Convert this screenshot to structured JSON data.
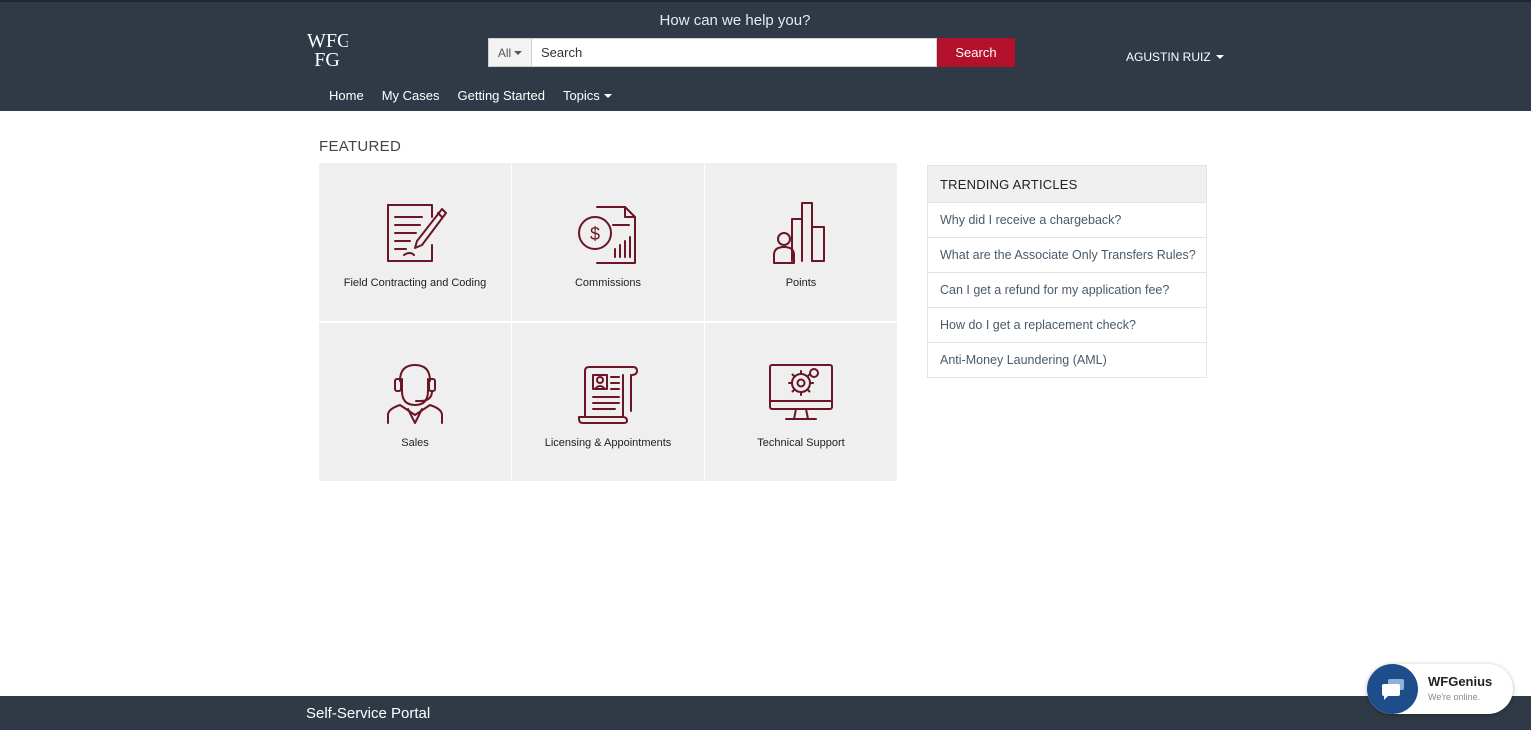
{
  "header": {
    "logo_text": "WFG",
    "help_text": "How can we help you?",
    "search": {
      "scope_label": "All",
      "placeholder": "Search",
      "button_label": "Search"
    },
    "user_name": "AGUSTIN RUIZ"
  },
  "nav": {
    "items": [
      {
        "label": "Home"
      },
      {
        "label": "My Cases"
      },
      {
        "label": "Getting Started"
      },
      {
        "label": "Topics"
      }
    ]
  },
  "featured": {
    "title": "FEATURED",
    "tiles": [
      {
        "label": "Field Contracting and Coding",
        "icon": "contract-signing-icon"
      },
      {
        "label": "Commissions",
        "icon": "commission-document-icon"
      },
      {
        "label": "Points",
        "icon": "points-chart-icon"
      },
      {
        "label": "Sales",
        "icon": "headset-agent-icon"
      },
      {
        "label": "Licensing & Appointments",
        "icon": "license-scroll-icon"
      },
      {
        "label": "Technical Support",
        "icon": "monitor-gear-icon"
      }
    ]
  },
  "trending": {
    "title": "TRENDING ARTICLES",
    "items": [
      {
        "label": "Why did I receive a chargeback?"
      },
      {
        "label": "What are the Associate Only Transfers Rules?"
      },
      {
        "label": "Can I get a refund for my application fee?"
      },
      {
        "label": "How do I get a replacement check?"
      },
      {
        "label": "Anti-Money Laundering (AML)"
      }
    ]
  },
  "footer": {
    "title": "Self-Service Portal"
  },
  "chat": {
    "name": "WFGenius",
    "status": "We're online."
  },
  "colors": {
    "header_bg": "#2f3a46",
    "accent": "#b3102c",
    "icon_stroke": "#6b1526",
    "tile_bg": "#efefef",
    "chat_blue": "#1e4d8c"
  }
}
